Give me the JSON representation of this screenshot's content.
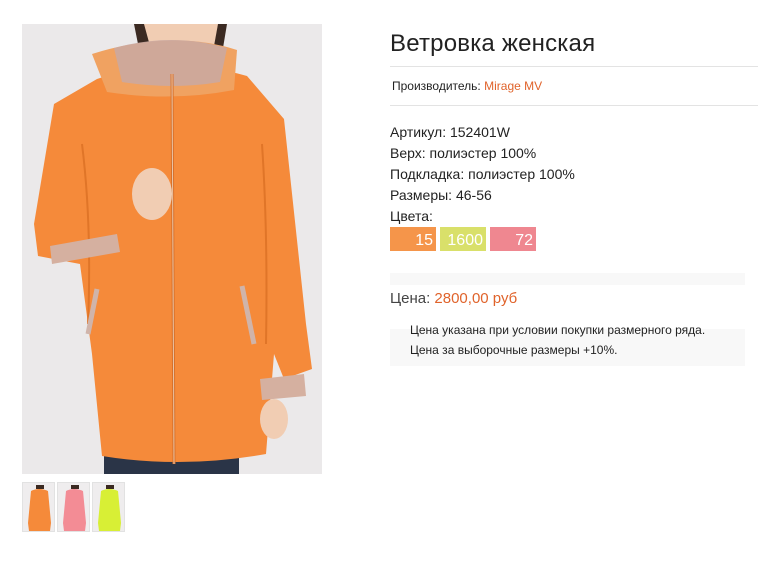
{
  "product": {
    "title": "Ветровка женская",
    "manufacturer_label": "Производитель:",
    "manufacturer_name": "Mirage MV",
    "specs": [
      "Артикул: 152401W",
      "Верх: полиэстер 100%",
      "Подкладка: полиэстер 100%",
      "Размеры: 46-56",
      "Цвета:"
    ],
    "colors": [
      {
        "code": "15",
        "hex": "#f5954a"
      },
      {
        "code": "1600",
        "hex": "#d9e06a"
      },
      {
        "code": "72",
        "hex": "#ef8790"
      }
    ],
    "price_label": "Цена:",
    "price_value": "2800,00 руб",
    "price_notes": [
      "Цена указана при условии покупки размерного ряда.",
      "Цена за выборочные размеры +10%."
    ]
  },
  "gallery": {
    "main_jacket_color": "#f58a3a",
    "thumbnails": [
      {
        "name": "orange",
        "color": "#f58a3a"
      },
      {
        "name": "pink",
        "color": "#f38c95"
      },
      {
        "name": "lime",
        "color": "#d8ef35"
      }
    ]
  }
}
